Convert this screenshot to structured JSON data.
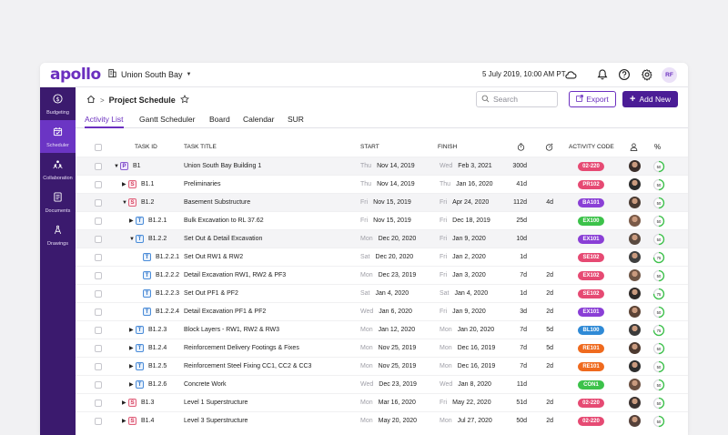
{
  "app": {
    "logo": "apollo",
    "project": "Union South Bay",
    "datetime": "5 July 2019, 10:00 AM PT",
    "user_initials": "RF"
  },
  "icons": {
    "project": "building-icon",
    "weather": "cloud-icon",
    "notifications": "bell-icon",
    "help": "help-icon",
    "settings": "gear-icon"
  },
  "sidebar": {
    "items": [
      {
        "label": "Budgeting",
        "icon": "dollar-icon"
      },
      {
        "label": "Scheduler",
        "icon": "calendar-icon",
        "active": true
      },
      {
        "label": "Collaboration",
        "icon": "people-icon"
      },
      {
        "label": "Documents",
        "icon": "document-icon"
      },
      {
        "label": "Drawings",
        "icon": "compass-icon"
      }
    ]
  },
  "page": {
    "title": "Project Schedule",
    "search_placeholder": "Search",
    "export_label": "Export",
    "add_label": "Add New"
  },
  "tabs": [
    "Activity List",
    "Gantt Scheduler",
    "Board",
    "Calendar",
    "SUR"
  ],
  "table": {
    "headers": {
      "task_id": "TASK ID",
      "task_title": "TASK TITLE",
      "start": "START",
      "finish": "FINISH",
      "duration": "duration-icon",
      "float": "float-icon",
      "activity_code": "ACTIVITY CODE",
      "assignee": "assignee-icon",
      "percent": "%"
    },
    "rows": [
      {
        "level": 0,
        "expand": "open",
        "type": "P",
        "id": "B1",
        "title": "Union South Bay Building 1",
        "start_dow": "Thu",
        "start": "Nov 14, 2019",
        "finish_dow": "Wed",
        "finish": "Feb 3, 2021",
        "dur": "300d",
        "float": "",
        "code": "02-220",
        "color": "#e64a73",
        "pct": 50,
        "shaded": true
      },
      {
        "level": 1,
        "expand": "closed",
        "type": "S",
        "id": "B1.1",
        "title": "Preliminaries",
        "start_dow": "Thu",
        "start": "Nov 14, 2019",
        "finish_dow": "Thu",
        "finish": "Jan 16, 2020",
        "dur": "41d",
        "float": "",
        "code": "PR102",
        "color": "#e64a73",
        "pct": 50,
        "shaded": false
      },
      {
        "level": 1,
        "expand": "open",
        "type": "S",
        "id": "B1.2",
        "title": "Basement Substructure",
        "start_dow": "Fri",
        "start": "Nov 15, 2019",
        "finish_dow": "Fri",
        "finish": "Apr 24, 2020",
        "dur": "112d",
        "float": "4d",
        "code": "BA101",
        "color": "#8a3fd6",
        "pct": 50,
        "shaded": true
      },
      {
        "level": 2,
        "expand": "closed",
        "type": "T",
        "id": "B1.2.1",
        "title": "Bulk Excavation to RL 37.62",
        "start_dow": "Fri",
        "start": "Nov 15, 2019",
        "finish_dow": "Fri",
        "finish": "Dec 18, 2019",
        "dur": "25d",
        "float": "",
        "code": "EX100",
        "color": "#3cc24a",
        "pct": 50,
        "shaded": false
      },
      {
        "level": 2,
        "expand": "open",
        "type": "T",
        "id": "B1.2.2",
        "title": "Set Out & Detail Excavation",
        "start_dow": "Mon",
        "start": "Dec 20, 2020",
        "finish_dow": "Fri",
        "finish": "Jan 9, 2020",
        "dur": "10d",
        "float": "",
        "code": "EX101",
        "color": "#8a3fd6",
        "pct": 50,
        "shaded": true
      },
      {
        "level": 3,
        "expand": "none",
        "type": "T",
        "id": "B1.2.2.1",
        "title": "Set Out RW1 & RW2",
        "start_dow": "Sat",
        "start": "Dec 20, 2020",
        "finish_dow": "Fri",
        "finish": "Jan 2, 2020",
        "dur": "1d",
        "float": "",
        "code": "SE102",
        "color": "#e64a73",
        "pct": 75,
        "shaded": false
      },
      {
        "level": 3,
        "expand": "none",
        "type": "T",
        "id": "B1.2.2.2",
        "title": "Detail Excavation RW1, RW2 & PF3",
        "start_dow": "Mon",
        "start": "Dec 23, 2019",
        "finish_dow": "Fri",
        "finish": "Jan 3, 2020",
        "dur": "7d",
        "float": "2d",
        "code": "EX102",
        "color": "#e64a73",
        "pct": 50,
        "shaded": false
      },
      {
        "level": 3,
        "expand": "none",
        "type": "T",
        "id": "B1.2.2.3",
        "title": "Set Out PF1 & PF2",
        "start_dow": "Sat",
        "start": "Jan 4, 2020",
        "finish_dow": "Sat",
        "finish": "Jan 4, 2020",
        "dur": "1d",
        "float": "2d",
        "code": "SE102",
        "color": "#e64a73",
        "pct": 75,
        "shaded": false
      },
      {
        "level": 3,
        "expand": "none",
        "type": "T",
        "id": "B1.2.2.4",
        "title": "Detail Excavation PF1 & PF2",
        "start_dow": "Wed",
        "start": "Jan 6, 2020",
        "finish_dow": "Fri",
        "finish": "Jan 9, 2020",
        "dur": "3d",
        "float": "2d",
        "code": "EX101",
        "color": "#8a3fd6",
        "pct": 50,
        "shaded": false
      },
      {
        "level": 2,
        "expand": "closed",
        "type": "T",
        "id": "B1.2.3",
        "title": "Block Layers - RW1, RW2 & RW3",
        "start_dow": "Mon",
        "start": "Jan 12, 2020",
        "finish_dow": "Mon",
        "finish": "Jan 20, 2020",
        "dur": "7d",
        "float": "5d",
        "code": "BL100",
        "color": "#2f8ad6",
        "pct": 75,
        "shaded": false
      },
      {
        "level": 2,
        "expand": "closed",
        "type": "T",
        "id": "B1.2.4",
        "title": "Reinforcement Delivery Footings & Fixes",
        "start_dow": "Mon",
        "start": "Nov 25, 2019",
        "finish_dow": "Mon",
        "finish": "Dec 16, 2019",
        "dur": "7d",
        "float": "5d",
        "code": "RE101",
        "color": "#ef6a1e",
        "pct": 50,
        "shaded": false
      },
      {
        "level": 2,
        "expand": "closed",
        "type": "T",
        "id": "B1.2.5",
        "title": "Reinforcement Steel Fixing CC1, CC2 & CC3",
        "start_dow": "Mon",
        "start": "Nov 25, 2019",
        "finish_dow": "Mon",
        "finish": "Dec 16, 2019",
        "dur": "7d",
        "float": "2d",
        "code": "RE101",
        "color": "#ef6a1e",
        "pct": 50,
        "shaded": false
      },
      {
        "level": 2,
        "expand": "closed",
        "type": "T",
        "id": "B1.2.6",
        "title": "Concrete Work",
        "start_dow": "Wed",
        "start": "Dec 23, 2019",
        "finish_dow": "Wed",
        "finish": "Jan 8, 2020",
        "dur": "11d",
        "float": "",
        "code": "CON1",
        "color": "#3cc24a",
        "pct": 50,
        "shaded": false
      },
      {
        "level": 1,
        "expand": "closed",
        "type": "S",
        "id": "B1.3",
        "title": "Level 1 Superstructure",
        "start_dow": "Mon",
        "start": "Mar 16, 2020",
        "finish_dow": "Fri",
        "finish": "May 22, 2020",
        "dur": "51d",
        "float": "2d",
        "code": "02-220",
        "color": "#e64a73",
        "pct": 50,
        "shaded": false
      },
      {
        "level": 1,
        "expand": "closed",
        "type": "S",
        "id": "B1.4",
        "title": "Level 3 Superstructure",
        "start_dow": "Mon",
        "start": "May 20, 2020",
        "finish_dow": "Mon",
        "finish": "Jul 27, 2020",
        "dur": "50d",
        "float": "2d",
        "code": "02-220",
        "color": "#e64a73",
        "pct": 50,
        "shaded": false
      }
    ]
  },
  "avatar_tones": [
    "#3a2e2a",
    "#2b2b2b",
    "#4a3b33",
    "#7a5a48",
    "#5a4a40",
    "#3f3f3f",
    "#6e5545",
    "#2f2a28",
    "#5c4436",
    "#3a3a3a",
    "#4d3a30",
    "#2e2e2e",
    "#6a4f40",
    "#3b3230",
    "#55413a"
  ],
  "accent": "#6b2fbf"
}
